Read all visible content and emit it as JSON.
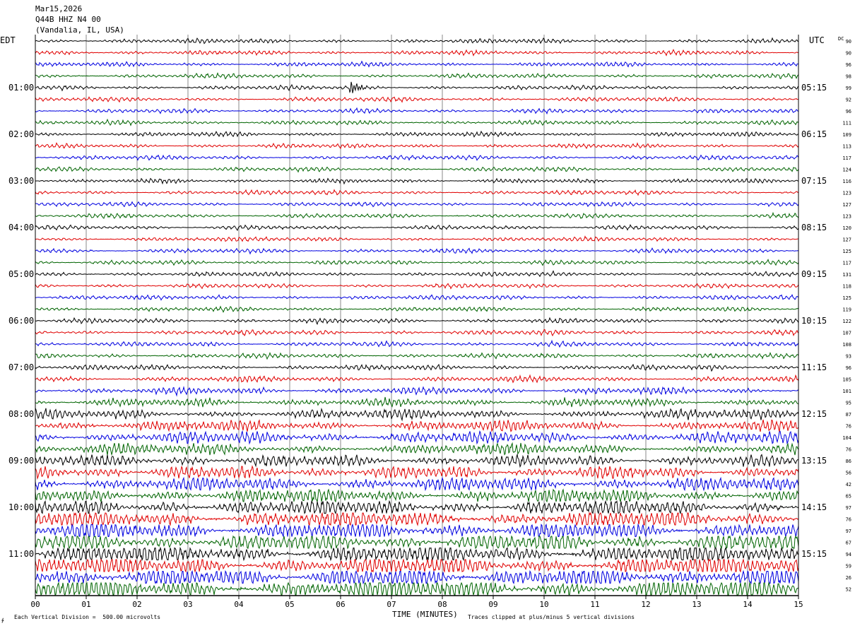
{
  "header": {
    "date": "Mar15,2026",
    "station": "Q44B HHZ N4 00",
    "location": "(Vandalia, IL, USA)"
  },
  "left_tz": "EDT",
  "right_tz": "UTC",
  "dc_label": "DC",
  "footer": {
    "scale_note": "Each Vertical Division =  500.00 microvolts",
    "xlabel": "TIME (MINUTES)",
    "clip_note": "Traces clipped at plus/minus 5 vertical divisions"
  },
  "chart_data": {
    "type": "line",
    "x_ticks": [
      "00",
      "01",
      "02",
      "03",
      "04",
      "05",
      "06",
      "07",
      "08",
      "09",
      "10",
      "11",
      "12",
      "13",
      "14",
      "15"
    ],
    "xlim": [
      0,
      15
    ],
    "left_hour_labels": [
      "01:00",
      "02:00",
      "03:00",
      "04:00",
      "05:00",
      "06:00",
      "07:00",
      "08:00",
      "09:00",
      "10:00",
      "11:00"
    ],
    "right_hour_labels": [
      "05:15",
      "06:15",
      "07:15",
      "08:15",
      "09:15",
      "10:15",
      "11:15",
      "12:15",
      "13:15",
      "14:15",
      "15:15"
    ],
    "first_labeled_line_index": 4,
    "trace_colors": [
      "#000000",
      "#e00000",
      "#0000e0",
      "#006400"
    ],
    "dc_offsets": [
      90,
      90,
      96,
      98,
      99,
      92,
      96,
      111,
      109,
      113,
      117,
      124,
      116,
      123,
      127,
      123,
      120,
      127,
      125,
      117,
      131,
      118,
      125,
      119,
      122,
      107,
      108,
      93,
      96,
      105,
      101,
      95,
      87,
      76,
      104,
      76,
      86,
      56,
      42,
      65,
      97,
      76,
      97,
      67,
      94,
      59,
      26,
      52
    ],
    "amplitude_levels": [
      1.0,
      1.0,
      1.0,
      1.0,
      1.0,
      1.0,
      1.0,
      1.0,
      1.0,
      1.0,
      1.0,
      1.0,
      1.0,
      1.0,
      1.0,
      1.0,
      1.0,
      1.0,
      1.0,
      1.0,
      1.0,
      1.0,
      1.0,
      1.0,
      1.1,
      1.1,
      1.1,
      1.1,
      1.2,
      1.3,
      1.6,
      1.8,
      2.2,
      2.5,
      2.8,
      2.5,
      2.6,
      3.0,
      3.2,
      3.2,
      3.6,
      4.0,
      4.0,
      4.2,
      4.4,
      4.4,
      4.6,
      4.8
    ],
    "events": [
      {
        "line": 4,
        "minute": 6.2,
        "amplitude": 4.5
      }
    ]
  }
}
